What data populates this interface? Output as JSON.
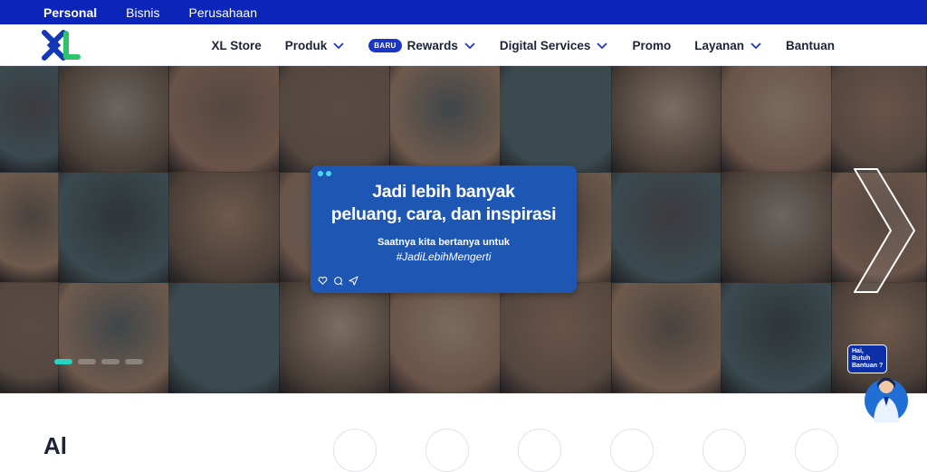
{
  "topbar": {
    "items": [
      "Personal",
      "Bisnis",
      "Perusahaan"
    ]
  },
  "nav": {
    "logo": "xl-logo",
    "items": [
      {
        "label": "XL Store",
        "dropdown": false
      },
      {
        "label": "Produk",
        "dropdown": true
      },
      {
        "label": "Rewards",
        "dropdown": true,
        "badge": "BARU"
      },
      {
        "label": "Digital Services",
        "dropdown": true
      },
      {
        "label": "Promo",
        "dropdown": false
      },
      {
        "label": "Layanan",
        "dropdown": true
      },
      {
        "label": "Bantuan",
        "dropdown": false
      }
    ]
  },
  "hero": {
    "card": {
      "line1": "Jadi lebih banyak",
      "line2": "peluang, cara, dan inspirasi",
      "sub": "Saatnya kita bertanya untuk",
      "tag": "#JadiLebihMengerti"
    },
    "slides_total": 4,
    "active_slide": 1
  },
  "helper": {
    "bubble": [
      "Hai,",
      "Butuh",
      "Bantuan ?"
    ]
  },
  "below": {
    "title_partial": "Al"
  },
  "colors": {
    "brand_blue": "#0a25b8",
    "card_blue": "#1e56b3",
    "accent_teal": "#27d3c2"
  }
}
